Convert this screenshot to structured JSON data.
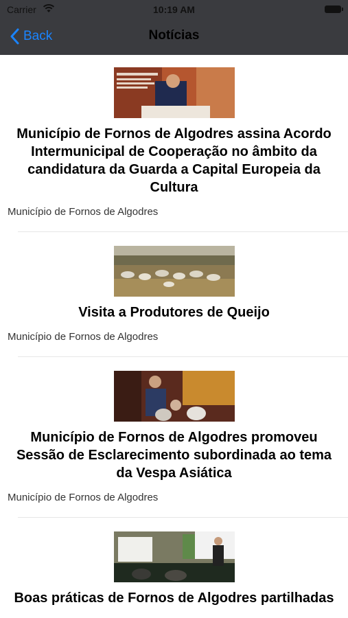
{
  "status_bar": {
    "carrier": "Carrier",
    "time": "10:19 AM"
  },
  "nav": {
    "back_label": "Back",
    "title": "Notícias"
  },
  "articles": [
    {
      "title": "Município de Fornos de Algodres assina Acordo Intermunicipal de Cooperação no âmbito da candidatura da Guarda a Capital Europeia da Cultura",
      "source": "Município de Fornos de Algodres"
    },
    {
      "title": "Visita a Produtores de Queijo",
      "source": "Município de Fornos de Algodres"
    },
    {
      "title": "Município de Fornos de Algodres promoveu Sessão de Esclarecimento subordinada ao tema da Vespa Asiática",
      "source": "Município de Fornos de Algodres"
    },
    {
      "title": "Boas práticas de Fornos de Algodres partilhadas",
      "source": ""
    }
  ],
  "colors": {
    "nav_bg": "#3a3b3f",
    "accent": "#1a84ff"
  }
}
